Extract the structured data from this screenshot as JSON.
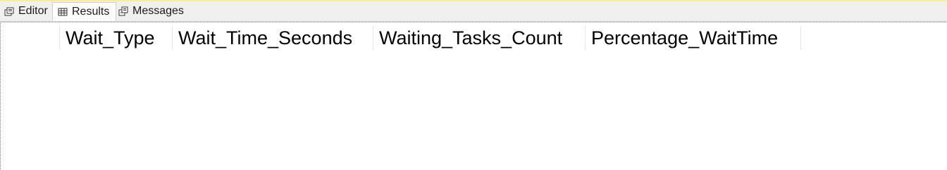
{
  "tabs": {
    "editor": {
      "label": "Editor",
      "icon": "editor-icon"
    },
    "results": {
      "label": "Results",
      "icon": "grid-icon",
      "active": true
    },
    "messages": {
      "label": "Messages",
      "icon": "messages-icon"
    }
  },
  "results_grid": {
    "columns": [
      "Wait_Type",
      "Wait_Time_Seconds",
      "Waiting_Tasks_Count",
      "Percentage_WaitTime"
    ],
    "rows": []
  },
  "colors": {
    "accent_strip": "#f5eda0",
    "tabbar_bg": "#f0f0f0",
    "grid_line": "#e4e4e4"
  }
}
